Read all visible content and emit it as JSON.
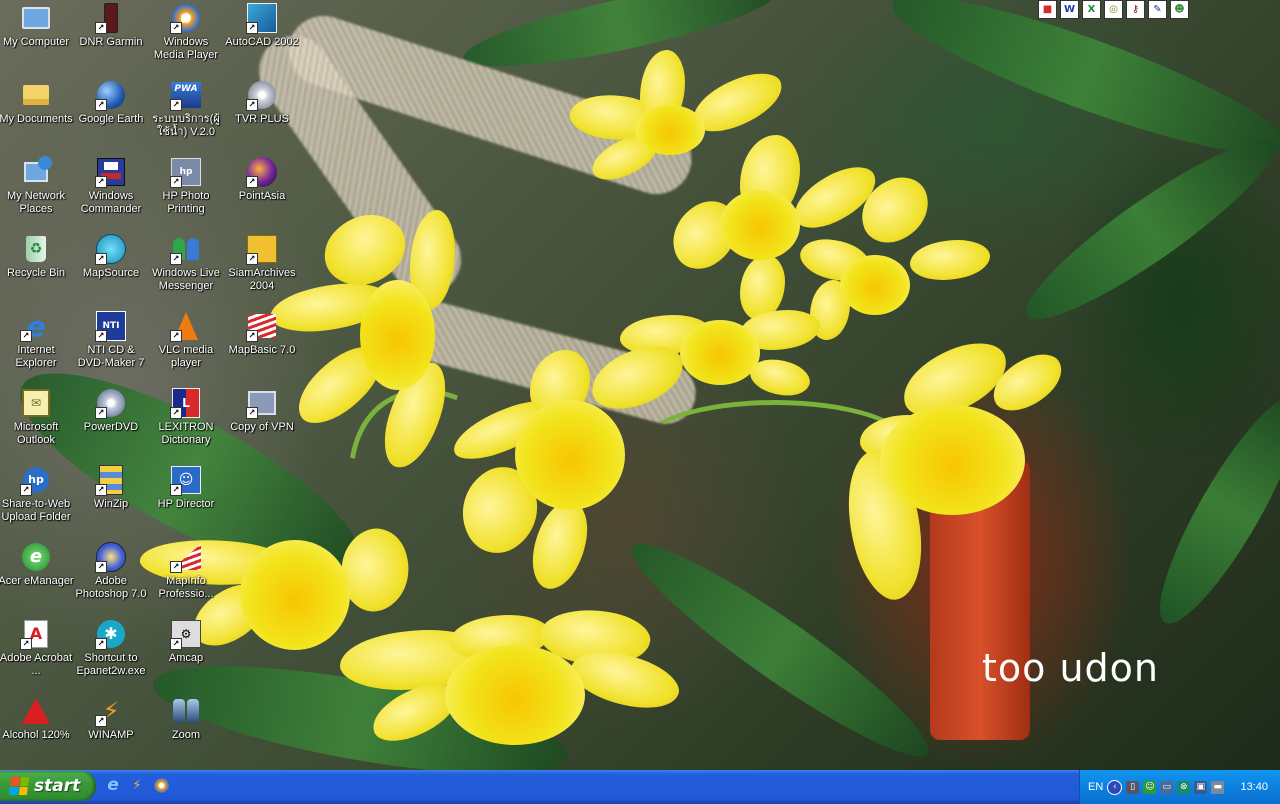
{
  "desktop": {
    "watermark": "too udon",
    "icons": [
      {
        "label": "My Computer",
        "icon": "my-computer-icon"
      },
      {
        "label": "My Documents",
        "icon": "my-documents-icon"
      },
      {
        "label": "My Network Places",
        "icon": "network-places-icon"
      },
      {
        "label": "Recycle Bin",
        "icon": "recycle-bin-icon"
      },
      {
        "label": "Internet Explorer",
        "icon": "internet-explorer-icon"
      },
      {
        "label": "Microsoft Outlook",
        "icon": "outlook-icon"
      },
      {
        "label": "Share-to-Web Upload Folder",
        "icon": "hp-share-icon"
      },
      {
        "label": "Acer eManager",
        "icon": "acer-emanager-icon"
      },
      {
        "label": "Adobe Acrobat ...",
        "icon": "adobe-acrobat-icon"
      },
      {
        "label": "Alcohol 120%",
        "icon": "alcohol-icon"
      },
      {
        "label": "DNR Garmin",
        "icon": "garmin-icon"
      },
      {
        "label": "Google Earth",
        "icon": "google-earth-icon"
      },
      {
        "label": "Windows Commander",
        "icon": "windows-commander-icon"
      },
      {
        "label": "MapSource",
        "icon": "mapsource-icon"
      },
      {
        "label": "NTI CD & DVD-Maker 7",
        "icon": "nti-icon"
      },
      {
        "label": "PowerDVD",
        "icon": "powerdvd-icon"
      },
      {
        "label": "WinZip",
        "icon": "winzip-icon"
      },
      {
        "label": "Adobe Photoshop 7.0",
        "icon": "photoshop-icon"
      },
      {
        "label": "Shortcut to Epanet2w.exe",
        "icon": "epanet-icon"
      },
      {
        "label": "WINAMP",
        "icon": "winamp-icon"
      },
      {
        "label": "Windows Media Player",
        "icon": "media-player-icon"
      },
      {
        "label": "ระบบบริการ(ผู้ใช้น้ำ) V.2.0",
        "icon": "pwa-icon"
      },
      {
        "label": "HP Photo Printing",
        "icon": "hp-photo-icon"
      },
      {
        "label": "Windows Live Messenger",
        "icon": "messenger-icon"
      },
      {
        "label": "VLC media player",
        "icon": "vlc-icon"
      },
      {
        "label": "LEXITRON Dictionary",
        "icon": "lexitron-icon"
      },
      {
        "label": "HP Director",
        "icon": "hp-director-icon"
      },
      {
        "label": "MapInfo Professio...",
        "icon": "mapinfo-icon"
      },
      {
        "label": "Amcap",
        "icon": "amcap-icon"
      },
      {
        "label": "Zoom",
        "icon": "zoom-icon"
      },
      {
        "label": "AutoCAD 2002",
        "icon": "autocad-icon"
      },
      {
        "label": "TVR PLUS",
        "icon": "tvr-icon"
      },
      {
        "label": "PointAsia",
        "icon": "pointasia-icon"
      },
      {
        "label": "SiamArchives 2004",
        "icon": "siamarchives-icon"
      },
      {
        "label": "MapBasic 7.0",
        "icon": "mapbasic-icon"
      },
      {
        "label": "Copy of VPN",
        "icon": "vpn-icon"
      }
    ]
  },
  "office_toolbar": {
    "items": [
      "office-icon",
      "word-icon",
      "excel-icon",
      "publisher-icon",
      "access-icon",
      "outlook-icon",
      "office-assistant-icon"
    ]
  },
  "taskbar": {
    "start_label": "start",
    "quick_launch": [
      "internet-explorer-icon",
      "winamp-icon",
      "media-player-icon"
    ],
    "tray": {
      "language": "EN",
      "clock": "13:40"
    }
  }
}
